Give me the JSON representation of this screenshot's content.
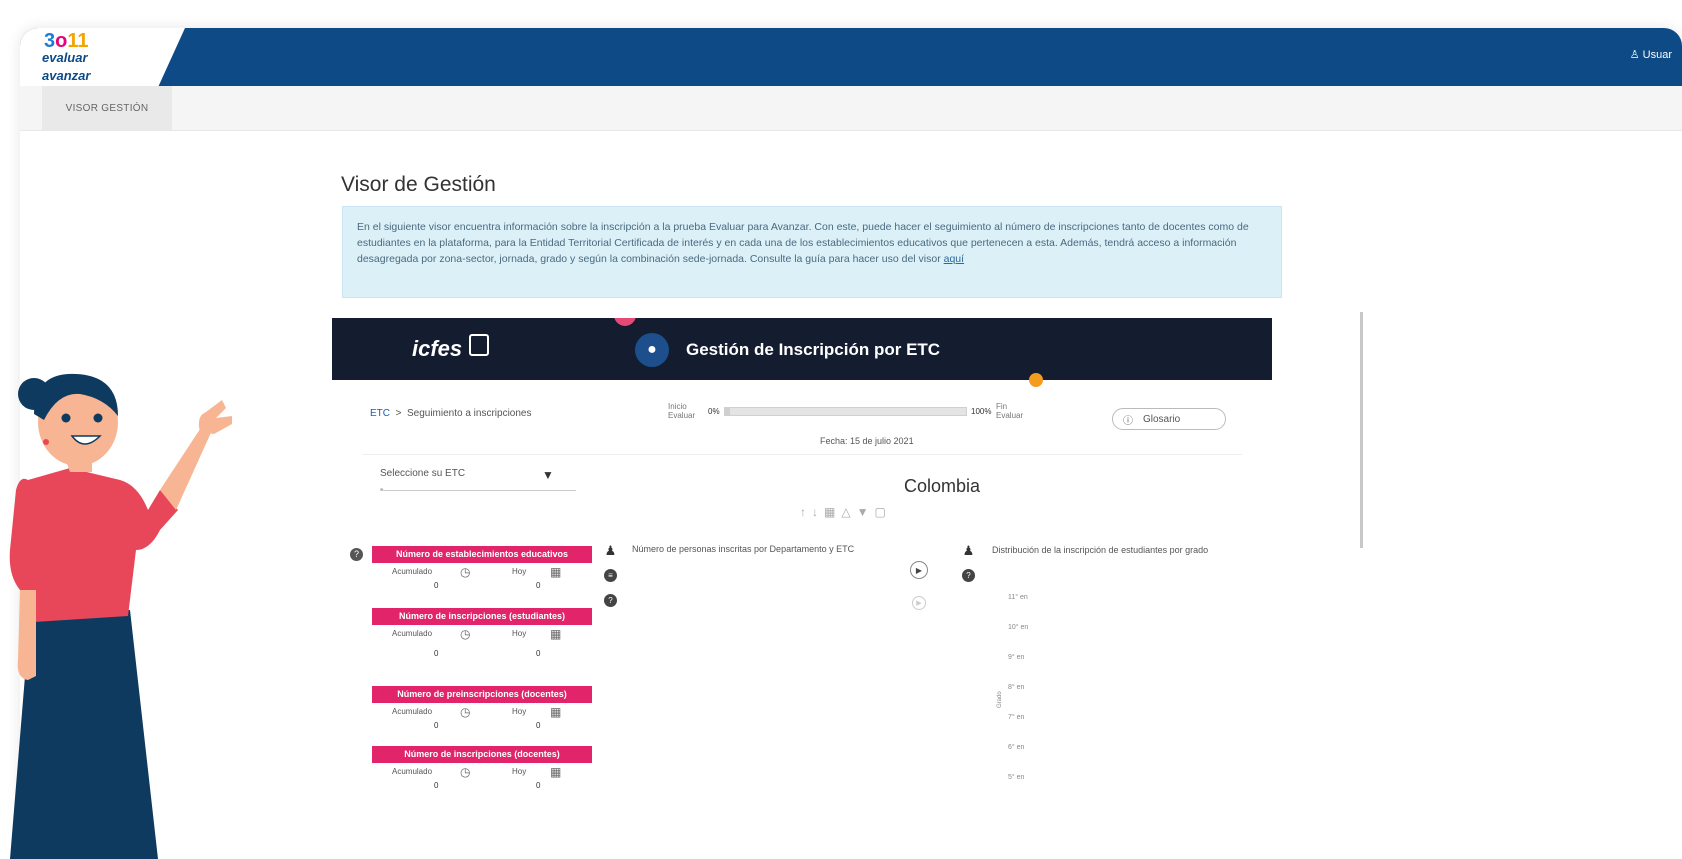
{
  "header": {
    "logo_number": "3",
    "logo_o": "o",
    "logo_11": "11",
    "logo_line1": "evaluar",
    "logo_line2": "avanzar",
    "user_label": "Usuar"
  },
  "subnav": {
    "tab_label": "VISOR GESTIÓN"
  },
  "page": {
    "title": "Visor de Gestión",
    "info_text": "En el siguiente visor encuentra información sobre la inscripción a la prueba Evaluar para Avanzar. Con este, puede hacer el seguimiento al número de inscripciones tanto de docentes como de estudiantes en la plataforma, para la Entidad Territorial Certificada de interés y en cada una de los establecimientos educativos que pertenecen a esta. Además, tendrá acceso a información desagregada por zona-sector, jornada, grado y según la combinación sede-jornada. Consulte la guía para hacer uso del visor",
    "info_link": "aquí"
  },
  "dashboard": {
    "logo_text": "icfes",
    "title": "Gestión de Inscripción por ETC",
    "breadcrumb": {
      "root": "ETC",
      "sep": ">",
      "current": "Seguimiento a inscripciones"
    },
    "progress": {
      "left_top": "Inicio",
      "left_bottom": "Evaluar",
      "start_pct": "0%",
      "end_pct": "100%",
      "right_top": "Fin",
      "right_bottom": "Evaluar",
      "value": 0.02
    },
    "date": "Fecha: 15 de julio 2021",
    "glossary_label": "Glosario",
    "select_label": "Seleccione su ETC",
    "select_value": "-",
    "country": "Colombia",
    "cards": [
      {
        "title": "Número de establecimientos educativos",
        "acc_label": "Acumulado",
        "hoy_label": "Hoy",
        "acc_value": "0",
        "hoy_value": "0"
      },
      {
        "title": "Número de inscripciones (estudiantes)",
        "acc_label": "Acumulado",
        "hoy_label": "Hoy",
        "acc_value": "0",
        "hoy_value": "0"
      },
      {
        "title": "Número de preinscripciones (docentes)",
        "acc_label": "Acumulado",
        "hoy_label": "Hoy",
        "acc_value": "0",
        "hoy_value": "0"
      },
      {
        "title": "Número de inscripciones (docentes)",
        "acc_label": "Acumulado",
        "hoy_label": "Hoy",
        "acc_value": "0",
        "hoy_value": "0"
      }
    ],
    "chart1_title": "Número de personas inscritas por Departamento y ETC",
    "chart2_title": "Distribución de la inscripción de estudiantes por grado",
    "grade_axis_label": "Grado",
    "grades": [
      "11° en",
      "10° en",
      "9° en",
      "8° en",
      "7° en",
      "6° en",
      "5° en"
    ]
  },
  "colors": {
    "topbar": "#0d4a86",
    "dash_header": "#141c30",
    "card_header": "#e2246a",
    "info_bg": "#dcf0f8"
  }
}
